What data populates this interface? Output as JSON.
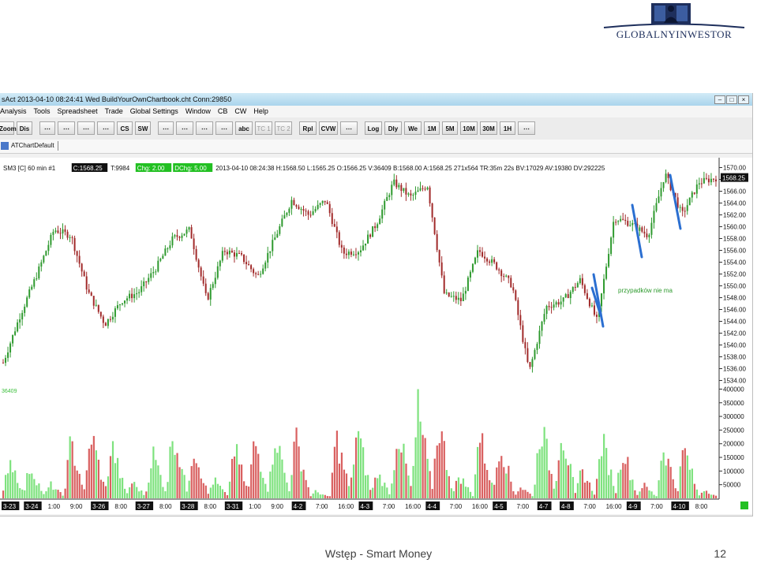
{
  "logo": {
    "brand": "GLOBALNYINWESTOR"
  },
  "window": {
    "title": "sAct 2013-04-10 08:24:41 Wed  BuildYourOwnChartbook.cht Conn:29850",
    "controls": [
      "minimize",
      "maximize",
      "close"
    ]
  },
  "menu": [
    "Analysis",
    "Tools",
    "Spreadsheet",
    "Trade",
    "Global Settings",
    "Window",
    "CB",
    "CW",
    "Help"
  ],
  "toolbar": {
    "buttons": [
      "Zoom",
      "Dis",
      "",
      "",
      "",
      "",
      "CS",
      "SW",
      "",
      "",
      "",
      "",
      "abc",
      "TC 1",
      "TC 2",
      "Rpl",
      "CVW",
      "",
      "Log",
      "Dly",
      "We",
      "1M",
      "5M",
      "10M",
      "30M",
      "1H",
      ""
    ],
    "dim_buttons": [
      "TC 1",
      "TC 2"
    ]
  },
  "tab": {
    "label": "ATChartDefault"
  },
  "chart_header": {
    "symbol": "SM3 [C] 60 min  #1",
    "close_badge": "C:1568.25",
    "tick": "T:9984",
    "chg_badge": "Chg: 2.00",
    "dchg_badge": "DChg: 5.00",
    "details": "2013-04-10 08:24:38 H:1568.50 L:1565.25 O:1566.25 V:36409 B:1568.00 A:1568.25 271x564 TR:35m 22s BV:17029 AV:19380 DV:292225"
  },
  "volume_label": "36409",
  "annotation": "przypadków nie ma",
  "price_axis": {
    "current_label": "1568.25",
    "ticks": [
      "1570.00",
      "1568.00",
      "1566.00",
      "1564.00",
      "1562.00",
      "1560.00",
      "1558.00",
      "1556.00",
      "1554.00",
      "1552.00",
      "1550.00",
      "1548.00",
      "1546.00",
      "1544.00",
      "1542.00",
      "1540.00",
      "1538.00",
      "1536.00",
      "1534.00"
    ]
  },
  "volume_axis": {
    "ticks": [
      "400000",
      "350000",
      "300000",
      "250000",
      "200000",
      "150000",
      "100000",
      "50000"
    ]
  },
  "time_axis": {
    "labels": [
      {
        "text": "3-23",
        "boxed": true
      },
      {
        "text": "3-24",
        "boxed": true
      },
      {
        "text": "1:00",
        "boxed": false
      },
      {
        "text": "9:00",
        "boxed": false
      },
      {
        "text": "3-26",
        "boxed": true
      },
      {
        "text": "8:00",
        "boxed": false
      },
      {
        "text": "3-27",
        "boxed": true
      },
      {
        "text": "8:00",
        "boxed": false
      },
      {
        "text": "3-28",
        "boxed": true
      },
      {
        "text": "8:00",
        "boxed": false
      },
      {
        "text": "3-31",
        "boxed": true
      },
      {
        "text": "1:00",
        "boxed": false
      },
      {
        "text": "9:00",
        "boxed": false
      },
      {
        "text": "4-2",
        "boxed": true
      },
      {
        "text": "7:00",
        "boxed": false
      },
      {
        "text": "16:00",
        "boxed": false
      },
      {
        "text": "4-3",
        "boxed": true
      },
      {
        "text": "7:00",
        "boxed": false
      },
      {
        "text": "16:00",
        "boxed": false
      },
      {
        "text": "4-4",
        "boxed": true
      },
      {
        "text": "7:00",
        "boxed": false
      },
      {
        "text": "16:00",
        "boxed": false
      },
      {
        "text": "4-5",
        "boxed": true
      },
      {
        "text": "7:00",
        "boxed": false
      },
      {
        "text": "4-7",
        "boxed": true
      },
      {
        "text": "4-8",
        "boxed": true
      },
      {
        "text": "7:00",
        "boxed": false
      },
      {
        "text": "16:00",
        "boxed": false
      },
      {
        "text": "4-9",
        "boxed": true
      },
      {
        "text": "7:00",
        "boxed": false
      },
      {
        "text": "4-10",
        "boxed": true
      },
      {
        "text": "8:00",
        "boxed": false
      }
    ]
  },
  "chart_data": {
    "type": "candlestick",
    "ylim": [
      1533,
      1571
    ],
    "volume_ylim": [
      0,
      410000
    ],
    "anchor_prices": [
      1537.0,
      1545.0,
      1552.0,
      1559.5,
      1558.5,
      1549.0,
      1543.5,
      1547.5,
      1549.0,
      1553.0,
      1558.0,
      1559.5,
      1547.5,
      1556.0,
      1555.0,
      1551.5,
      1558.0,
      1564.5,
      1562.0,
      1564.5,
      1555.5,
      1556.0,
      1560.5,
      1567.5,
      1565.0,
      1567.0,
      1548.5,
      1547.5,
      1556.0,
      1553.5,
      1550.0,
      1535.5,
      1546.5,
      1547.5,
      1551.0,
      1544.0,
      1561.5,
      1560.5,
      1558.5,
      1569.0,
      1562.0,
      1567.5,
      1568.25
    ],
    "volume_peaks": [
      180000,
      140000,
      60000,
      240000,
      280000,
      230000,
      70000,
      200000,
      300000,
      230000,
      80000,
      220000,
      250000,
      280000,
      260000,
      30000,
      260000,
      300000,
      110000,
      300000,
      380000,
      330000,
      100000,
      280000,
      250000,
      50000,
      330000,
      300000,
      120000,
      250000,
      220000,
      60000,
      230000,
      220000,
      40000
    ],
    "blue_trendlines": 4,
    "annotation": "przypadków nie ma"
  },
  "footer": {
    "text": "Wstęp - Smart Money",
    "page": "12"
  },
  "colors": {
    "up": "#2f9a2f",
    "down": "#a12a2a",
    "vol_up": "#7ee27e",
    "vol_down": "#d96060",
    "trendline": "#2b6fd1",
    "annotation": "#2d9a2d"
  }
}
